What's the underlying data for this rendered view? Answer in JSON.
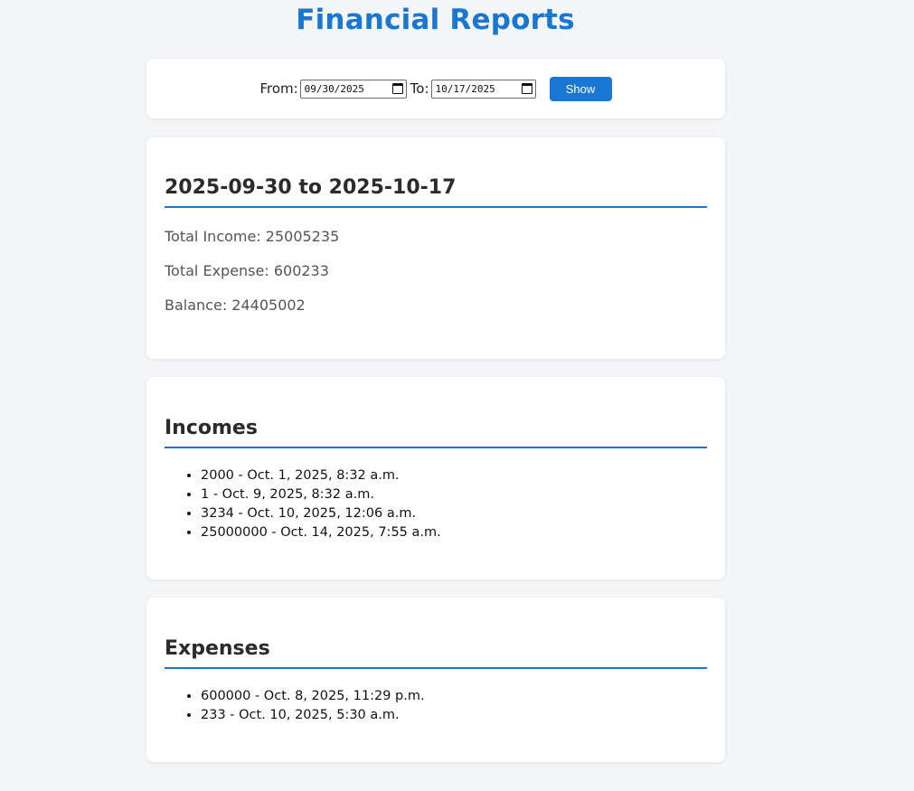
{
  "page": {
    "title": "Financial Reports"
  },
  "filter": {
    "from_label": "From:",
    "from_value": "09/30/2025",
    "to_label": "To:",
    "to_value": "10/17/2025",
    "show_label": "Show"
  },
  "summary": {
    "heading": "2025-09-30 to 2025-10-17",
    "total_income": "Total Income: 25005235",
    "total_expense": "Total Expense: 600233",
    "balance": "Balance: 24405002"
  },
  "incomes": {
    "heading": "Incomes",
    "items": [
      "2000 - Oct. 1, 2025, 8:32 a.m.",
      "1 - Oct. 9, 2025, 8:32 a.m.",
      "3234 - Oct. 10, 2025, 12:06 a.m.",
      "25000000 - Oct. 14, 2025, 7:55 a.m."
    ]
  },
  "expenses": {
    "heading": "Expenses",
    "items": [
      "600000 - Oct. 8, 2025, 11:29 p.m.",
      "233 - Oct. 10, 2025, 5:30 a.m."
    ]
  },
  "colors": {
    "accent": "#1976d2",
    "background": "#f4f5f7",
    "card": "#ffffff"
  },
  "icons": {
    "date_picker": "calendar-icon"
  }
}
